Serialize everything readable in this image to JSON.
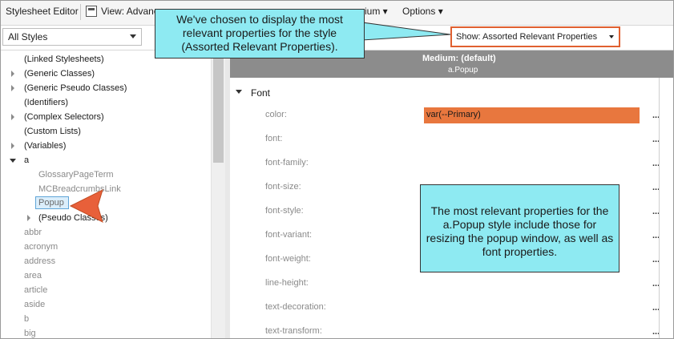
{
  "toolbar": {
    "editor_title": "Stylesheet Editor",
    "view_label": "View: Advanc",
    "medium_label": "ium ▾",
    "options_label": "Options ▾"
  },
  "filter": {
    "styles_select_value": "All Styles",
    "show_select_value": "Show: Assorted Relevant Properties"
  },
  "tree": {
    "items": [
      "(Linked Stylesheets)",
      "(Generic Classes)",
      "(Generic Pseudo Classes)",
      "(Identifiers)",
      "(Complex Selectors)",
      "(Custom Lists)",
      "(Variables)",
      "a",
      "GlossaryPageTerm",
      "MCBreadcrumbsLink",
      "Popup",
      "(Pseudo Classes)",
      "abbr",
      "acronym",
      "address",
      "area",
      "article",
      "aside",
      "b",
      "big"
    ]
  },
  "panel": {
    "medium_title": "Medium: (default)",
    "style_name": "a.Popup",
    "group_label": "Font",
    "properties": [
      {
        "name": "color:",
        "value": "var(--Primary)"
      },
      {
        "name": "font:",
        "value": ""
      },
      {
        "name": "font-family:",
        "value": ""
      },
      {
        "name": "font-size:",
        "value": ""
      },
      {
        "name": "font-style:",
        "value": ""
      },
      {
        "name": "font-variant:",
        "value": ""
      },
      {
        "name": "font-weight:",
        "value": ""
      },
      {
        "name": "line-height:",
        "value": ""
      },
      {
        "name": "text-decoration:",
        "value": ""
      },
      {
        "name": "text-transform:",
        "value": ""
      }
    ],
    "ellipsis": "..."
  },
  "callouts": {
    "top": "We've chosen to display the most relevant properties for the style (Assorted Relevant Properties).",
    "bottom": "The most relevant properties for the a.Popup style include those for resizing the popup window, as well as font properties."
  },
  "colors": {
    "accent_orange": "#e8773e",
    "callout_cyan": "#8eeaf2",
    "highlight_border": "#e06030",
    "header_grey": "#8c8c8c"
  }
}
